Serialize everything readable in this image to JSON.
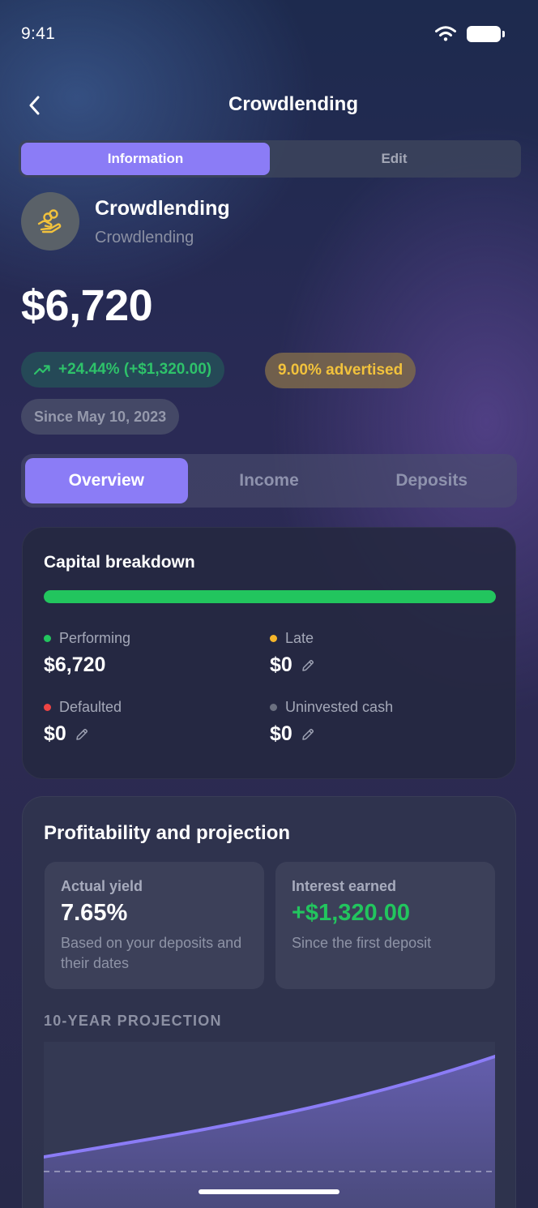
{
  "status_bar": {
    "time": "9:41"
  },
  "header": {
    "title": "Crowdlending"
  },
  "mode_tabs": [
    {
      "label": "Information",
      "active": true
    },
    {
      "label": "Edit",
      "active": false
    }
  ],
  "asset": {
    "name": "Crowdlending",
    "type": "Crowdlending",
    "icon": "hand-coins-icon",
    "icon_color": "#f2c23c"
  },
  "value": "$6,720",
  "badges": {
    "gain": "+24.44% (+$1,320.00)",
    "advertised": "9.00% advertised",
    "since": "Since May 10, 2023"
  },
  "section_tabs": [
    {
      "label": "Overview",
      "active": true
    },
    {
      "label": "Income",
      "active": false
    },
    {
      "label": "Deposits",
      "active": false
    }
  ],
  "capital": {
    "title": "Capital breakdown",
    "performing_fraction": 1.0,
    "items": [
      {
        "label": "Performing",
        "amount": "$6,720",
        "color": "#22c55e",
        "editable": false
      },
      {
        "label": "Late",
        "amount": "$0",
        "color": "#f5b52a",
        "editable": true
      },
      {
        "label": "Defaulted",
        "amount": "$0",
        "color": "#ef4444",
        "editable": true
      },
      {
        "label": "Uninvested cash",
        "amount": "$0",
        "color": "#6b7080",
        "editable": true
      }
    ]
  },
  "profitability": {
    "title": "Profitability and projection",
    "actual_yield": {
      "label": "Actual yield",
      "value": "7.65%",
      "sub": "Based on your deposits and their dates"
    },
    "interest": {
      "label": "Interest earned",
      "value": "+$1,320.00",
      "sub": "Since the first deposit"
    },
    "projection_label": "10-YEAR PROJECTION"
  },
  "colors": {
    "accent": "#8b7cf6",
    "positive": "#22c55e",
    "warning": "#f2c23c"
  }
}
